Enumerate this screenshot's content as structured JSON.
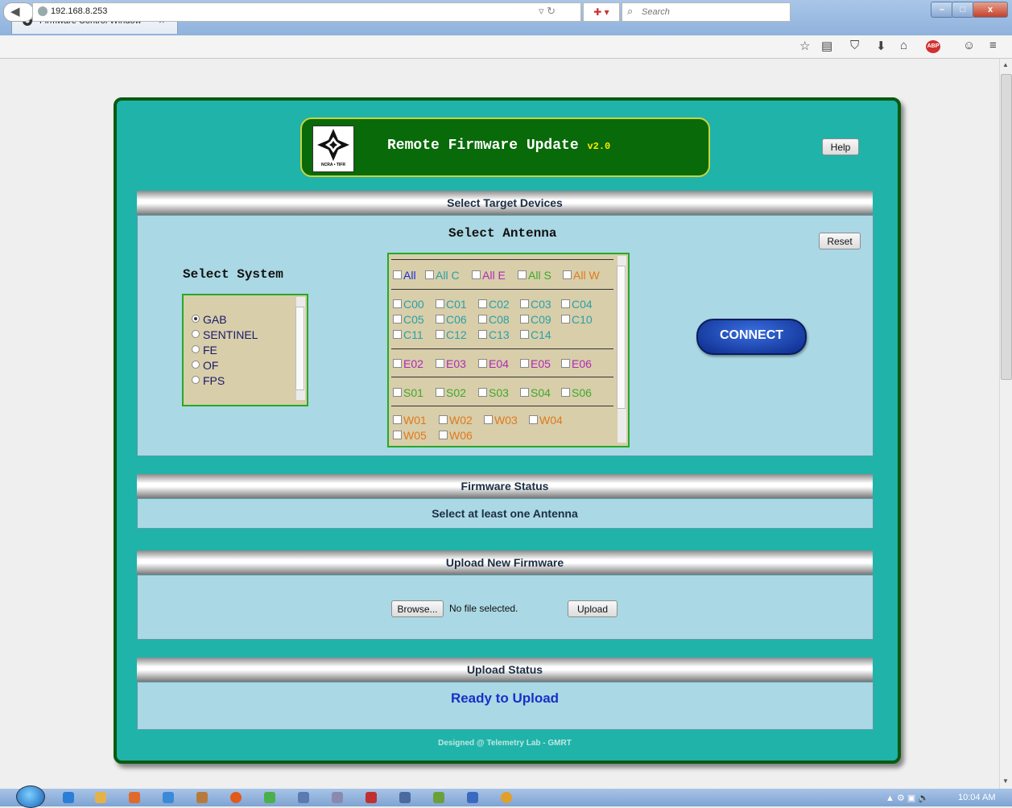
{
  "browser": {
    "tab_title": "Firmware Control Window",
    "tab_close": "×",
    "new_tab": "+",
    "url": "192.168.8.253",
    "search_placeholder": "Search"
  },
  "header": {
    "logo_caption": "NCRA • TIFR",
    "title": "Remote Firmware Update",
    "version": "v2.0",
    "help_label": "Help"
  },
  "target": {
    "section_title": "Select Target Devices",
    "select_system_label": "Select System",
    "systems": [
      {
        "label": "GAB",
        "selected": true
      },
      {
        "label": "SENTINEL",
        "selected": false
      },
      {
        "label": "FE",
        "selected": false
      },
      {
        "label": "OF",
        "selected": false
      },
      {
        "label": "FPS",
        "selected": false
      }
    ],
    "select_antenna_label": "Select Antenna",
    "reset_label": "Reset",
    "connect_label": "CONNECT",
    "all_groups": [
      "All",
      "All C",
      "All E",
      "All S",
      "All W"
    ],
    "c_antennas": [
      "C00",
      "C01",
      "C02",
      "C03",
      "C04",
      "C05",
      "C06",
      "C08",
      "C09",
      "C10",
      "C11",
      "C12",
      "C13",
      "C14"
    ],
    "e_antennas": [
      "E02",
      "E03",
      "E04",
      "E05",
      "E06"
    ],
    "s_antennas": [
      "S01",
      "S02",
      "S03",
      "S04",
      "S06"
    ],
    "w_antennas": [
      "W01",
      "W02",
      "W03",
      "W04",
      "W05",
      "W06"
    ],
    "colors": {
      "all": "#1f2fd6",
      "c": "#2aa0a8",
      "e": "#b02ab8",
      "s": "#3fa82a",
      "w": "#e07a1a"
    }
  },
  "firmware_status": {
    "section_title": "Firmware Status",
    "message": "Select at least one Antenna"
  },
  "upload": {
    "section_title": "Upload New Firmware",
    "browse_label": "Browse...",
    "file_status": "No file selected.",
    "upload_label": "Upload"
  },
  "upload_status": {
    "section_title": "Upload Status",
    "message": "Ready to Upload"
  },
  "footer": "Designed @ Telemetry Lab - GMRT",
  "taskbar": {
    "clock": "10:04 AM"
  }
}
